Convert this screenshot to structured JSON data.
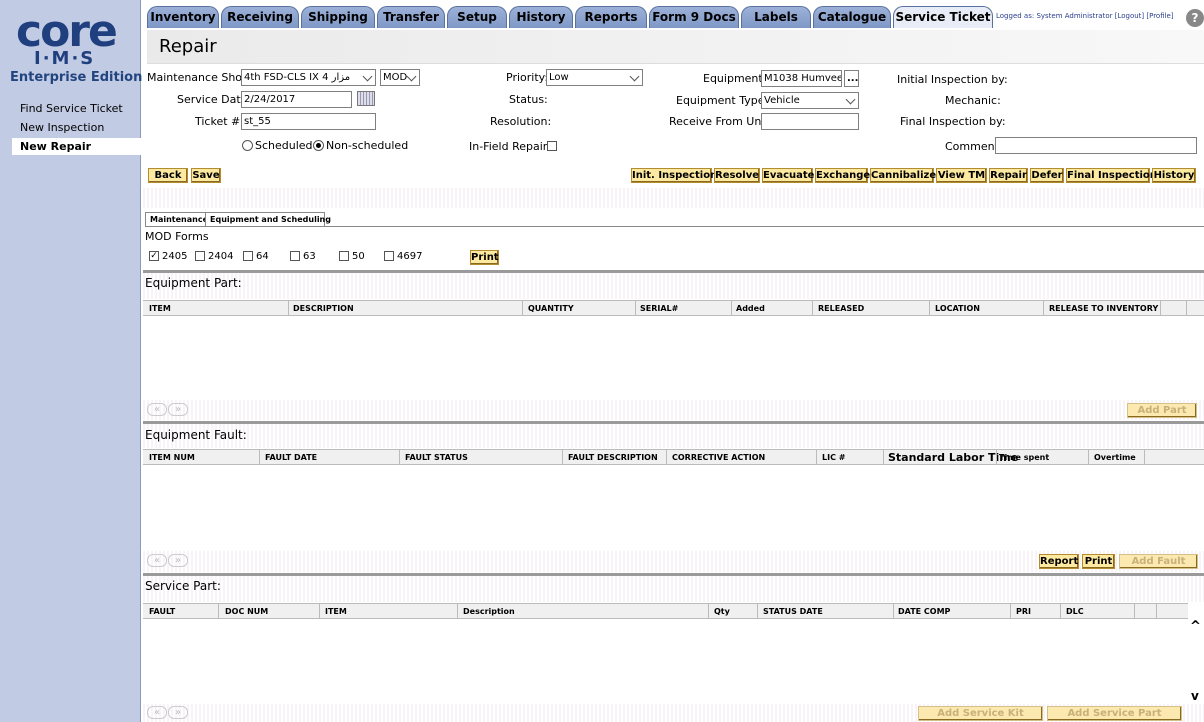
{
  "app": {
    "logo_top": "core",
    "logo_mid": "I·M·S",
    "logo_edition": "Enterprise Edition"
  },
  "sidebar": {
    "items": [
      {
        "label": "Find Service Ticket"
      },
      {
        "label": "New Inspection"
      },
      {
        "label": "New Repair"
      }
    ]
  },
  "tabs": [
    {
      "label": "Inventory"
    },
    {
      "label": "Receiving"
    },
    {
      "label": "Shipping"
    },
    {
      "label": "Transfer"
    },
    {
      "label": "Setup"
    },
    {
      "label": "History"
    },
    {
      "label": "Reports"
    },
    {
      "label": "Form 9 Docs"
    },
    {
      "label": "Labels"
    },
    {
      "label": "Catalogue"
    },
    {
      "label": "Service Ticket"
    }
  ],
  "header": {
    "login_text": "Logged as: System Administrator [Logout] [Profile]",
    "help_label": "?",
    "title": "Repair"
  },
  "form": {
    "maint_shop_label": "Maintenance Shop:",
    "maint_shop_value": "4th FSD-CLS IX مزار 4",
    "maint_shop_unit": "MOD",
    "service_date_label": "Service Date:",
    "service_date_value": "2/24/2017",
    "ticket_label": "Ticket #:",
    "ticket_value": "st_55",
    "scheduled_label": "Scheduled",
    "nonscheduled_label": "Non-scheduled",
    "priority_label": "Priority:",
    "priority_value": "Low",
    "status_label": "Status:",
    "resolution_label": "Resolution:",
    "infield_label": "In-Field Repair:",
    "equipment_label": "Equipment:",
    "equipment_value": "M1038 Humvee",
    "equipment_browse": "...",
    "equip_type_label": "Equipment Type:",
    "equip_type_value": "Vehicle",
    "receive_label": "Receive From Unit:",
    "init_insp_label": "Initial Inspection by:",
    "mechanic_label": "Mechanic:",
    "final_insp_label": "Final Inspection by:",
    "comment_label": "Comment:"
  },
  "actions": {
    "back": "Back",
    "save": "Save",
    "init_inspection": "Init. Inspection",
    "resolve": "Resolve",
    "evacuate": "Evacuate",
    "exchange": "Exchange",
    "cannibalize": "Cannibalize",
    "view_tm": "View TM",
    "repair": "Repair",
    "defer": "Defer",
    "final_inspection": "Final Inspection",
    "history": "History"
  },
  "subtabs": {
    "maintenance": "Maintenance",
    "equipment_scheduling": "Equipment and Scheduling"
  },
  "mod_forms": {
    "title": "MOD Forms",
    "items": [
      {
        "label": "2405",
        "checked": true
      },
      {
        "label": "2404",
        "checked": false
      },
      {
        "label": "64",
        "checked": false
      },
      {
        "label": "63",
        "checked": false
      },
      {
        "label": "50",
        "checked": false
      },
      {
        "label": "4697",
        "checked": false
      }
    ],
    "print": "Print",
    "check_mark": "✓"
  },
  "equipment_part": {
    "title": "Equipment Part:",
    "columns": [
      "ITEM",
      "DESCRIPTION",
      "QUANTITY",
      "SERIAL#",
      "Added",
      "RELEASED",
      "LOCATION",
      "RELEASE TO INVENTORY"
    ],
    "add_button": "Add Part"
  },
  "equipment_fault": {
    "title": "Equipment Fault:",
    "columns": [
      "ITEM NUM",
      "FAULT DATE",
      "FAULT STATUS",
      "FAULT DESCRIPTION",
      "CORRECTIVE ACTION",
      "LIC #",
      "Standard Labor Time",
      "Time spent",
      "Overtime"
    ],
    "report_button": "Report",
    "print_button": "Print",
    "add_button": "Add Fault"
  },
  "service_part": {
    "title": "Service Part:",
    "columns": [
      "FAULT",
      "DOC NUM",
      "ITEM",
      "Description",
      "Qty",
      "STATUS DATE",
      "DATE COMP",
      "PRI",
      "DLC"
    ],
    "add_kit_button": "Add Service Kit",
    "add_part_button": "Add Service Part"
  },
  "pager": {
    "prev": "«",
    "next": "»"
  },
  "scroll": {
    "up": "^",
    "down": "v"
  }
}
